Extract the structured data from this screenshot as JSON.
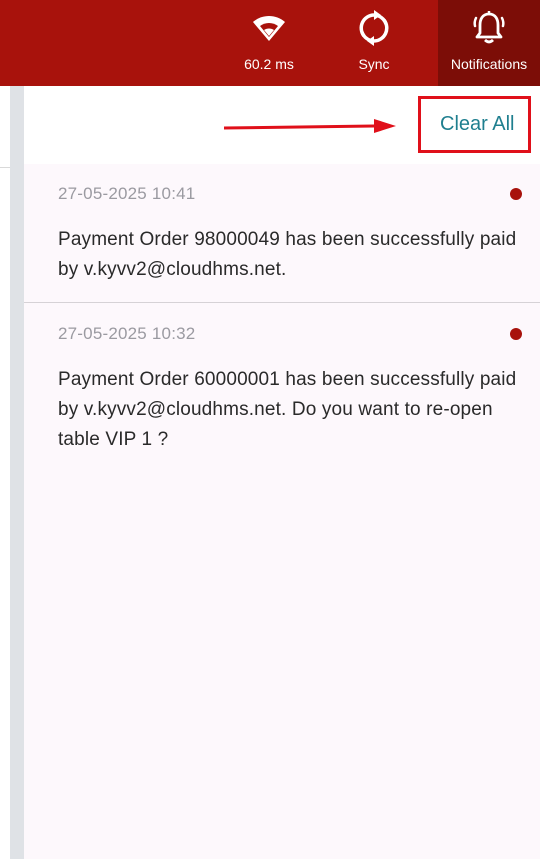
{
  "topbar": {
    "network": {
      "icon": "wifi-icon",
      "label": "60.2 ms"
    },
    "sync": {
      "icon": "sync-icon",
      "label": "Sync"
    },
    "notifications": {
      "icon": "bell-alert-icon",
      "label": "Notifications"
    },
    "color": "#a8120c",
    "active_color": "#7c0d07"
  },
  "panel": {
    "clear_all_label": "Clear All",
    "annotation": {
      "arrow_color": "#e0101a",
      "box_color": "#e0101a"
    }
  },
  "notifications": [
    {
      "time": "27-05-2025 10:41",
      "message": "Payment Order 98000049 has been successfully paid by v.kyvv2@cloudhms.net.",
      "unread": true
    },
    {
      "time": "27-05-2025 10:32",
      "message": "Payment Order 60000001 has been successfully paid by v.kyvv2@cloudhms.net. Do you want to re-open table VIP 1 ?",
      "unread": true
    }
  ],
  "colors": {
    "unread_dot": "#a8120c",
    "clear_all_text": "#1f7f8f"
  }
}
